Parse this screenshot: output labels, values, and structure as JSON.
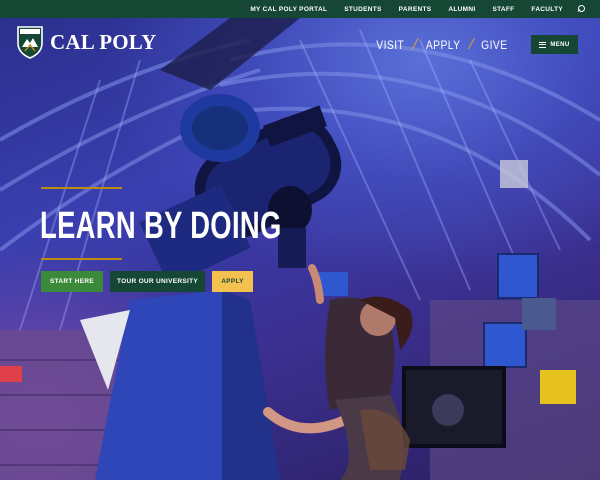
{
  "utility_nav": {
    "links": [
      "MY CAL POLY PORTAL",
      "STUDENTS",
      "PARENTS",
      "ALUMNI",
      "STAFF",
      "FACULTY"
    ],
    "search_icon": "search-icon"
  },
  "logo": {
    "wordmark": "CAL POLY",
    "shield_motto": "LEARN BY DOING"
  },
  "main_nav": {
    "links": [
      "VISIT",
      "APPLY",
      "GIVE"
    ],
    "menu_label": "MENU"
  },
  "hero": {
    "headline": "LEARN BY DOING",
    "buttons": {
      "start": "START HERE",
      "tour": "TOUR OUR UNIVERSITY",
      "apply": "APPLY"
    }
  },
  "colors": {
    "brand_green": "#154734",
    "accent_gold": "#bd8b13",
    "button_green": "#3a8a3a",
    "button_yellow": "#f2c14e"
  }
}
